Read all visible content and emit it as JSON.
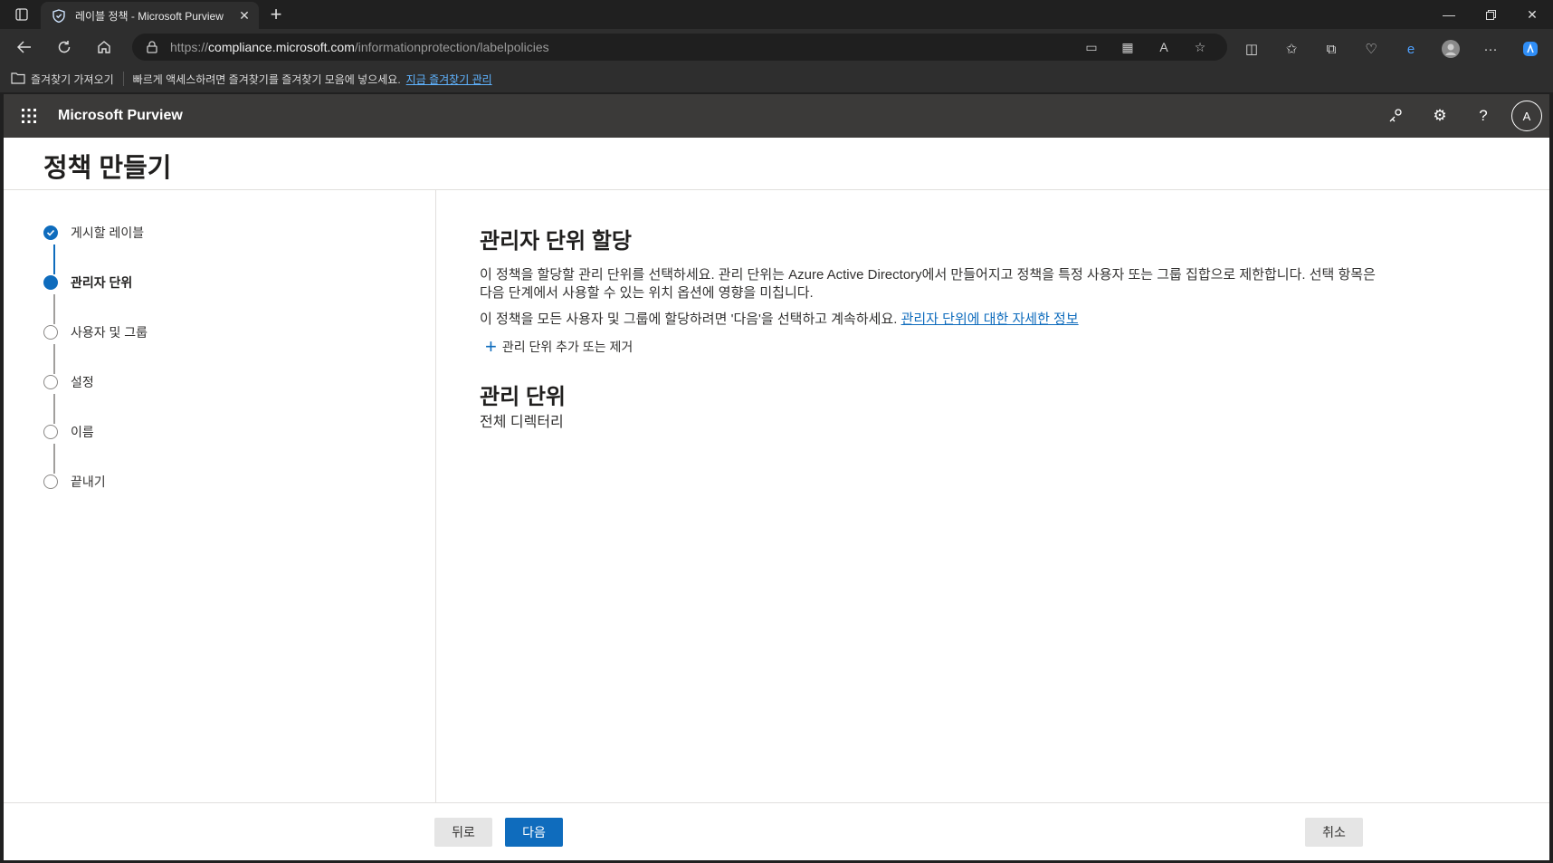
{
  "browser": {
    "tab_title": "레이블 정책 - Microsoft Purview",
    "url_prefix": "https://",
    "url_domain": "compliance.microsoft.com",
    "url_path": "/informationprotection/labelpolicies",
    "favorites_import": "즐겨찾기 가져오기",
    "favorites_hint": "빠르게 액세스하려면 즐겨찾기를 즐겨찾기 모음에 넣으세요.",
    "favorites_manage_link": "지금 즐겨찾기 관리"
  },
  "app": {
    "name": "Microsoft Purview",
    "avatar_initial": "A"
  },
  "page": {
    "title": "정책 만들기"
  },
  "steps": [
    {
      "label": "게시할 레이블",
      "state": "done"
    },
    {
      "label": "관리자 단위",
      "state": "current"
    },
    {
      "label": "사용자 및 그룹",
      "state": "pending"
    },
    {
      "label": "설정",
      "state": "pending"
    },
    {
      "label": "이름",
      "state": "pending"
    },
    {
      "label": "끝내기",
      "state": "pending"
    }
  ],
  "content": {
    "heading": "관리자 단위 할당",
    "description": "이 정책을 할당할 관리 단위를 선택하세요. 관리 단위는 Azure Active Directory에서 만들어지고 정책을 특정 사용자 또는 그룹 집합으로 제한합니다. 선택 항목은 다음 단계에서 사용할 수 있는 위치 옵션에 영향을 미칩니다.",
    "description2": "이 정책을 모든 사용자 및 그룹에 할당하려면 '다음'을 선택하고 계속하세요.",
    "learn_more_link": "관리자 단위에 대한 자세한 정보",
    "add_remove_label": "관리 단위 추가 또는 제거",
    "admin_units_heading": "관리 단위",
    "admin_units_value": "전체 디렉터리"
  },
  "footer": {
    "back_label": "뒤로",
    "next_label": "다음",
    "cancel_label": "취소"
  },
  "colors": {
    "accent": "#0f6cbd",
    "appbar": "#3b3a39"
  }
}
